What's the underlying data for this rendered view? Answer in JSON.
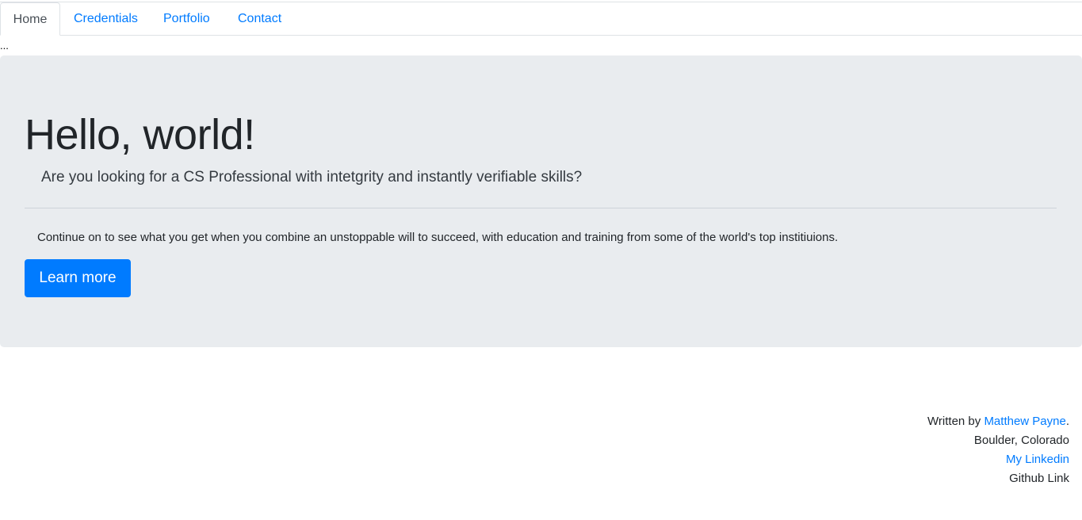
{
  "nav": {
    "tabs": [
      {
        "label": "Home",
        "active": true
      },
      {
        "label": "Credentials",
        "active": false
      },
      {
        "label": "Portfolio",
        "active": false
      },
      {
        "label": "Contact",
        "active": false
      }
    ]
  },
  "ellipsis": "...",
  "jumbotron": {
    "title": "Hello, world!",
    "lead": "Are you looking for a CS Professional with intetgrity and instantly verifiable skills?",
    "body": "Continue on to see what you get when you combine an unstoppable will to succeed, with education and training from some of the world's top institiuions.",
    "button_label": "Learn more"
  },
  "footer": {
    "written_by_prefix": "Written by ",
    "author_name": "Matthew Payne",
    "written_by_suffix": ".",
    "location": "Boulder, Colorado",
    "linkedin_label": "My Linkedin",
    "github_label": "Github Link"
  },
  "colors": {
    "link": "#007bff",
    "jumbotron_bg": "#e9ecef",
    "button_bg": "#007bff"
  }
}
